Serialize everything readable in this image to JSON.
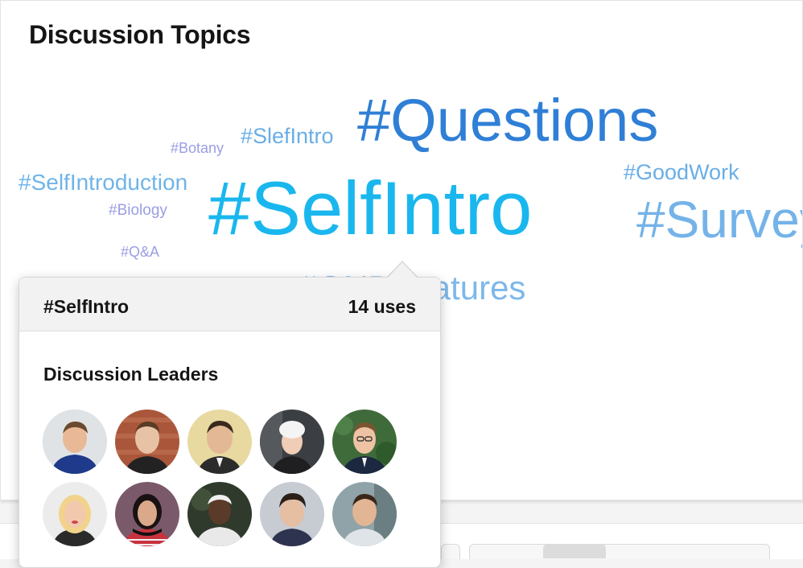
{
  "panel": {
    "title": "Discussion Topics"
  },
  "tags": [
    {
      "id": "questions",
      "label": "#Questions",
      "color": "#2f7fd6"
    },
    {
      "id": "slefintro",
      "label": "#SlefIntro",
      "color": "#6aaee6"
    },
    {
      "id": "botany",
      "label": "#Botany",
      "color": "#9a9ee3"
    },
    {
      "id": "selfintroduction",
      "label": "#SelfIntroduction",
      "color": "#6fb4e8"
    },
    {
      "id": "goodwork",
      "label": "#GoodWork",
      "color": "#6aaee6"
    },
    {
      "id": "biology",
      "label": "#Biology",
      "color": "#9a9ee3"
    },
    {
      "id": "selfintro",
      "label": "#SelfIntro",
      "color": "#1ab7ee"
    },
    {
      "id": "survey",
      "label": "#Survey",
      "color": "#74b3e9"
    },
    {
      "id": "qa",
      "label": "#Q&A",
      "color": "#9a9ee3"
    },
    {
      "id": "ond-features",
      "label": "#ONDFeatures",
      "color": "#7db8ea"
    }
  ],
  "popover": {
    "tag": "#SelfIntro",
    "count": "14 uses",
    "leaders_heading": "Discussion Leaders",
    "avatar_count": 10
  }
}
